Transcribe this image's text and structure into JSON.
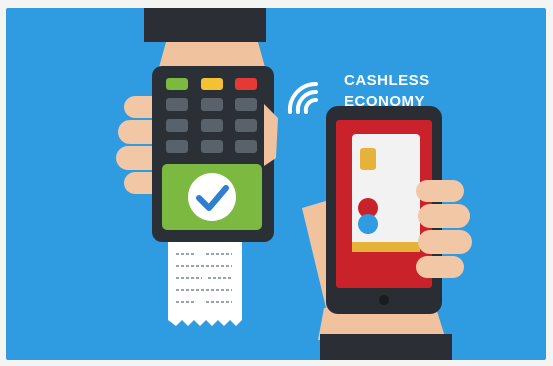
{
  "headline": {
    "line1": "CASHLESS",
    "line2": "ECONOMY"
  },
  "icons": {
    "wireless": "wireless-signal-icon",
    "checkmark": "checkmark-icon",
    "card_chip": "card-chip-icon",
    "card_brand": "card-brand-logo-icon"
  },
  "colors": {
    "background": "#2f9be0",
    "terminal_body": "#2b3036",
    "terminal_screen": "#7cb940",
    "phone_body": "#2a2d33",
    "phone_screen": "#c9222a",
    "card": "#f2f2f2",
    "skin": "#f2c7a5",
    "sleeve": "#2b2f35"
  }
}
